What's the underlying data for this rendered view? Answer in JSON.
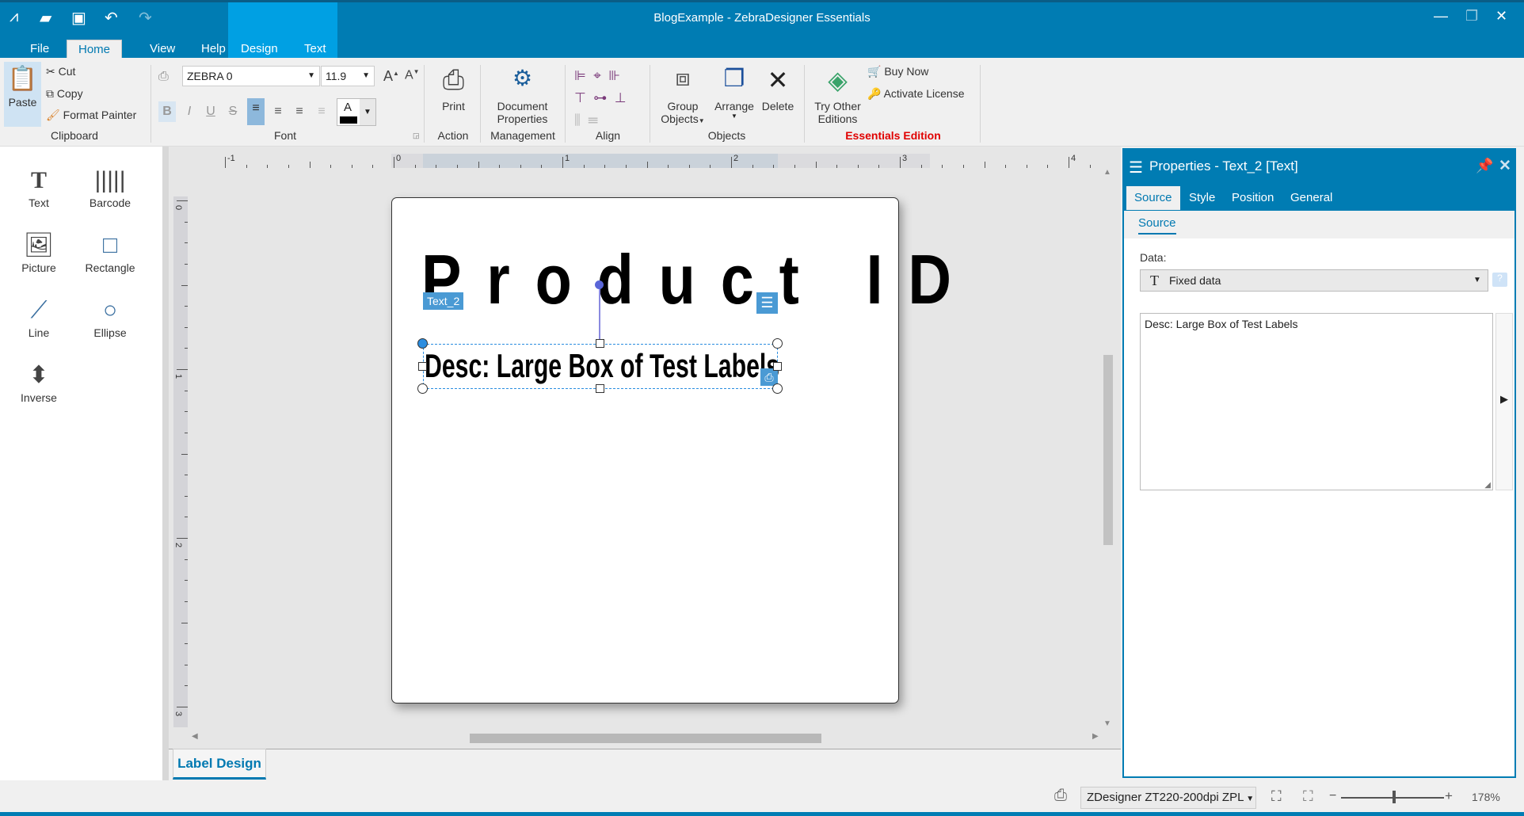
{
  "window": {
    "title": "BlogExample - ZebraDesigner Essentials"
  },
  "quick_access": {
    "icons": [
      "app-logo-icon",
      "open-folder-icon",
      "save-icon",
      "undo-icon",
      "redo-icon"
    ]
  },
  "menu_tabs": [
    {
      "label": "File"
    },
    {
      "label": "Home",
      "active": true
    },
    {
      "label": "View"
    },
    {
      "label": "Help"
    },
    {
      "label": "Design"
    },
    {
      "label": "Text"
    }
  ],
  "ribbon": {
    "clipboard": {
      "label": "Clipboard",
      "paste": "Paste",
      "cut": "Cut",
      "copy": "Copy",
      "format_painter": "Format Painter"
    },
    "font": {
      "label": "Font",
      "font_name": "ZEBRA 0",
      "font_size": "11.9",
      "bold": "B",
      "italic": "I",
      "underline": "U",
      "strike": "S",
      "color_letter": "A"
    },
    "action": {
      "label": "Action",
      "print": "Print"
    },
    "management": {
      "label": "Management",
      "document_properties_1": "Document",
      "document_properties_2": "Properties"
    },
    "align": {
      "label": "Align"
    },
    "objects": {
      "label": "Objects",
      "group_1": "Group",
      "group_2": "Objects",
      "arrange": "Arrange",
      "delete": "Delete"
    },
    "editions": {
      "label": "Essentials Edition",
      "label_color": "#e00000",
      "try_1": "Try Other",
      "try_2": "Editions",
      "buy_now": "Buy Now",
      "activate": "Activate License"
    }
  },
  "toolbox": [
    {
      "label": "Text",
      "icon": "text-icon"
    },
    {
      "label": "Barcode",
      "icon": "barcode-icon"
    },
    {
      "label": "Picture",
      "icon": "picture-icon"
    },
    {
      "label": "Rectangle",
      "icon": "rectangle-icon"
    },
    {
      "label": "Line",
      "icon": "line-icon"
    },
    {
      "label": "Ellipse",
      "icon": "ellipse-icon"
    },
    {
      "label": "Inverse",
      "icon": "inverse-icon"
    }
  ],
  "rulers": {
    "horizontal": [
      "-1",
      "0",
      "1",
      "2",
      "3",
      "4"
    ],
    "vertical": [
      "0",
      "1",
      "2",
      "3"
    ]
  },
  "label": {
    "product_id": "Product ID",
    "selected_name": "Text_2",
    "desc": "Desc: Large Box of Test Labels"
  },
  "bottom_tabs": [
    {
      "label": "Label Design",
      "active": true
    }
  ],
  "properties": {
    "title": "Properties - Text_2 [Text]",
    "tabs": [
      {
        "label": "Source",
        "active": true
      },
      {
        "label": "Style"
      },
      {
        "label": "Position"
      },
      {
        "label": "General"
      }
    ],
    "subtab": "Source",
    "data_label": "Data:",
    "data_value": "Fixed data",
    "text_value": "Desc: Large Box of Test Labels"
  },
  "status": {
    "printer": "ZDesigner ZT220-200dpi ZPL",
    "zoom": "178%",
    "zoom_level_percent": 178
  },
  "colors": {
    "accent": "#007cb3",
    "contextual_tab": "#00a0e3",
    "selection": "#2a8de0"
  }
}
